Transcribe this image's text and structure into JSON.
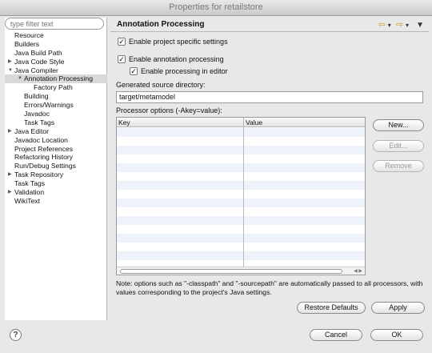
{
  "window": {
    "title": "Properties for retailstore"
  },
  "sidebar": {
    "filter_placeholder": "type filter text",
    "items": [
      {
        "label": "Resource",
        "indent": 0,
        "twisty": ""
      },
      {
        "label": "Builders",
        "indent": 0,
        "twisty": ""
      },
      {
        "label": "Java Build Path",
        "indent": 0,
        "twisty": ""
      },
      {
        "label": "Java Code Style",
        "indent": 0,
        "twisty": "collapsed"
      },
      {
        "label": "Java Compiler",
        "indent": 0,
        "twisty": "expanded"
      },
      {
        "label": "Annotation Processing",
        "indent": 1,
        "twisty": "expanded",
        "selected": true
      },
      {
        "label": "Factory Path",
        "indent": 2,
        "twisty": ""
      },
      {
        "label": "Building",
        "indent": 1,
        "twisty": ""
      },
      {
        "label": "Errors/Warnings",
        "indent": 1,
        "twisty": ""
      },
      {
        "label": "Javadoc",
        "indent": 1,
        "twisty": ""
      },
      {
        "label": "Task Tags",
        "indent": 1,
        "twisty": ""
      },
      {
        "label": "Java Editor",
        "indent": 0,
        "twisty": "collapsed"
      },
      {
        "label": "Javadoc Location",
        "indent": 0,
        "twisty": ""
      },
      {
        "label": "Project References",
        "indent": 0,
        "twisty": ""
      },
      {
        "label": "Refactoring History",
        "indent": 0,
        "twisty": ""
      },
      {
        "label": "Run/Debug Settings",
        "indent": 0,
        "twisty": ""
      },
      {
        "label": "Task Repository",
        "indent": 0,
        "twisty": "collapsed"
      },
      {
        "label": "Task Tags",
        "indent": 0,
        "twisty": ""
      },
      {
        "label": "Validation",
        "indent": 0,
        "twisty": "collapsed"
      },
      {
        "label": "WikiText",
        "indent": 0,
        "twisty": ""
      }
    ]
  },
  "main": {
    "title": "Annotation Processing",
    "nav_icons": [
      "back-arrow-icon",
      "forward-arrow-icon",
      "view-menu-icon"
    ],
    "enable_project_specific": {
      "label": "Enable project specific settings",
      "checked": true
    },
    "enable_annotation_processing": {
      "label": "Enable annotation processing",
      "checked": true
    },
    "enable_processing_in_editor": {
      "label": "Enable processing in editor",
      "checked": true
    },
    "generated_source_label": "Generated source directory:",
    "generated_source_value": "target/metamodel",
    "processor_options_label": "Processor options (-Akey=value):",
    "table": {
      "columns": [
        "Key",
        "Value"
      ],
      "rows": []
    },
    "buttons": {
      "new": "New...",
      "edit": "Edit...",
      "remove": "Remove"
    },
    "note": "Note: options such as \"-classpath\" and \"-sourcepath\" are automatically passed to all processors, with values corresponding to the project's Java settings.",
    "restore_defaults": "Restore Defaults",
    "apply": "Apply"
  },
  "footer": {
    "cancel": "Cancel",
    "ok": "OK",
    "help": "?"
  },
  "colors": {
    "accent_nav": "#d29a1b",
    "table_alt_row": "#eef3fb"
  }
}
